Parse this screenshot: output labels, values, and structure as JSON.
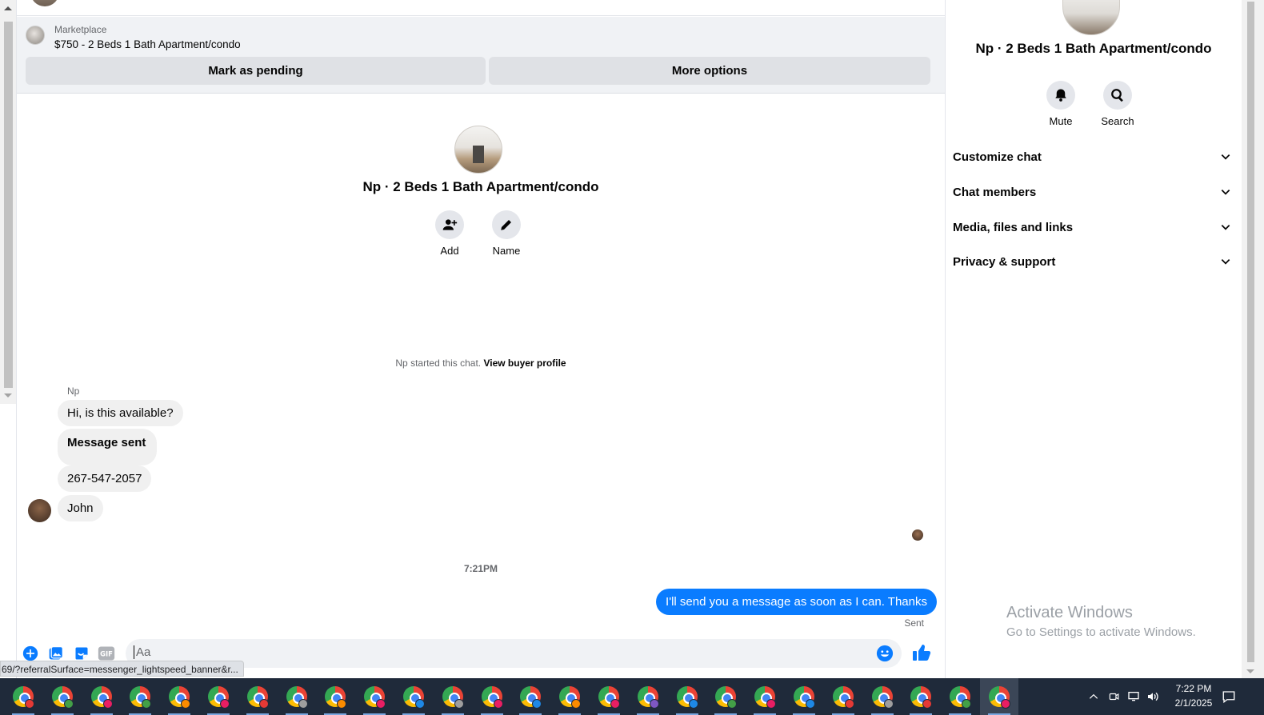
{
  "banner": {
    "label": "Marketplace",
    "title": "$750 - 2 Beds 1 Bath Apartment/condo",
    "mark_pending": "Mark as pending",
    "more_options": "More options"
  },
  "header": {
    "title": "Np · 2 Beds 1 Bath Apartment/condo",
    "add_label": "Add",
    "name_label": "Name"
  },
  "chat": {
    "started_text": "Np started this chat.",
    "view_profile": "View buyer profile",
    "sender_name": "Np",
    "messages_in": [
      "Hi, is this available?",
      "Message sent",
      "267-547-2057",
      "John"
    ],
    "time_separator": "7:21PM",
    "message_out": "I'll send you a message as soon as I can. Thanks",
    "sent_status": "Sent"
  },
  "composer": {
    "placeholder": "Aa"
  },
  "status_url": "69/?referralSurface=messenger_lightspeed_banner&r...",
  "side": {
    "title": "Np · 2 Beds 1 Bath Apartment/condo",
    "mute_label": "Mute",
    "search_label": "Search",
    "sections": [
      "Customize chat",
      "Chat members",
      "Media, files and links",
      "Privacy & support"
    ]
  },
  "watermark": {
    "line1": "Activate Windows",
    "line2": "Go to Settings to activate Windows."
  },
  "taskbar": {
    "time": "7:22 PM",
    "date": "2/1/2025",
    "badge_colors": [
      "#e53935",
      "#43a047",
      "#e91e63",
      "#43a047",
      "#fb8c00",
      "#e91e63",
      "#e53935",
      "#9e9e9e",
      "#fb8c00",
      "#e91e63",
      "#1e88e5",
      "#9e9e9e",
      "#e91e63",
      "#1e88e5",
      "#fb8c00",
      "#e91e63",
      "#7e57c2",
      "#1e88e5",
      "#43a047",
      "#e91e63",
      "#1e88e5",
      "#e53935",
      "#9e9e9e",
      "#e53935",
      "#43a047",
      "#e91e63"
    ]
  },
  "colors": {
    "accent": "#0a7cff",
    "bubble_in": "#f0f0f0",
    "button_bg": "#dfe1e5",
    "taskbar": "#1f2a3a"
  }
}
